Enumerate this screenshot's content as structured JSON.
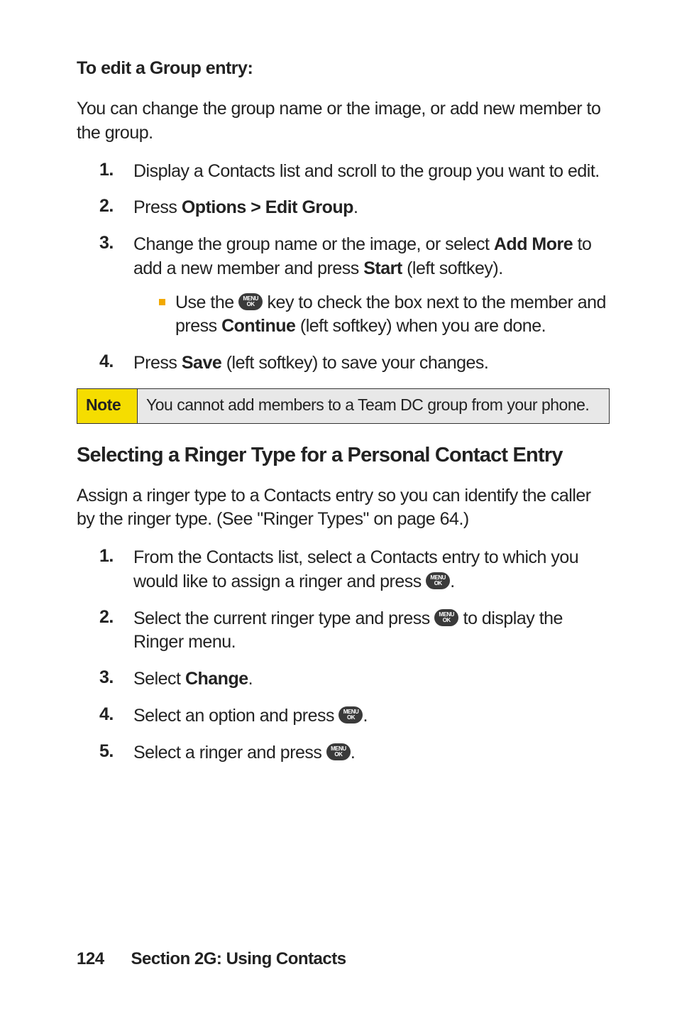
{
  "heading1": "To edit a Group entry:",
  "intro1": "You can change the group name or the image, or add new member to the group.",
  "steps1": {
    "n1": "1.",
    "t1": "Display a Contacts list and scroll to the group you want to edit.",
    "n2": "2.",
    "t2a": "Press ",
    "t2b": "Options > Edit Group",
    "t2c": ".",
    "n3": "3.",
    "t3a": "Change the group name or the image, or select ",
    "t3b": "Add More",
    "t3c": " to add a new member and press ",
    "t3d": "Start",
    "t3e": " (left softkey).",
    "sub3a": "Use the ",
    "sub3b": " key to check the box next to the member and press ",
    "sub3c": "Continue",
    "sub3d": " (left softkey) when you are done.",
    "n4": "4.",
    "t4a": "Press ",
    "t4b": "Save",
    "t4c": " (left softkey) to save your changes."
  },
  "note": {
    "label": "Note",
    "body": "You cannot add members to a Team DC group from your phone."
  },
  "heading2": "Selecting a Ringer Type for a Personal Contact Entry",
  "intro2": "Assign a ringer type to a Contacts entry so you can identify the caller by the ringer type. (See \"Ringer Types\" on page 64.)",
  "steps2": {
    "n1": "1.",
    "t1a": "From the Contacts list, select a Contacts entry to which you would like to assign a ringer and press ",
    "t1b": ".",
    "n2": "2.",
    "t2a": "Select the current ringer type and press ",
    "t2b": " to display the Ringer menu.",
    "n3": "3.",
    "t3a": "Select ",
    "t3b": "Change",
    "t3c": ".",
    "n4": "4.",
    "t4a": "Select an option and press ",
    "t4b": ".",
    "n5": "5.",
    "t5a": "Select a ringer and press ",
    "t5b": "."
  },
  "menukey": {
    "l1": "MENU",
    "l2": "OK"
  },
  "footer": {
    "page": "124",
    "section": "Section 2G: Using Contacts"
  }
}
